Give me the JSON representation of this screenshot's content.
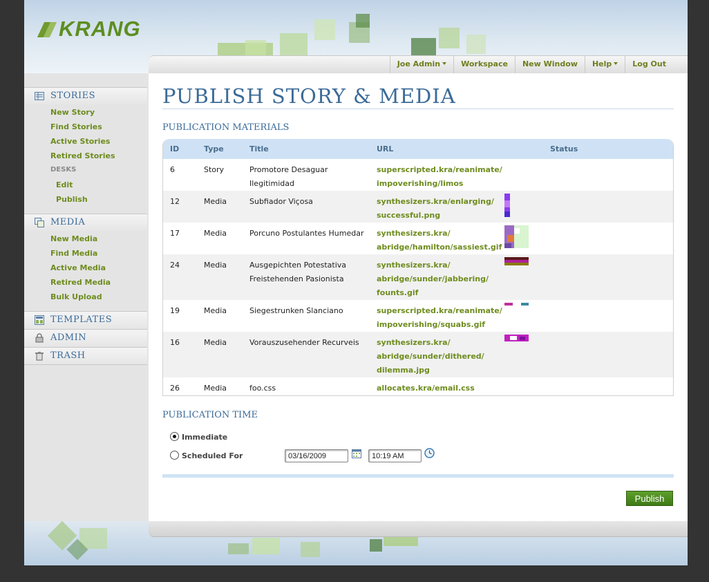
{
  "brand": {
    "name": "KRANG"
  },
  "nav": {
    "user": "Joe Admin",
    "workspace": "Workspace",
    "new_window": "New Window",
    "help": "Help",
    "logout": "Log Out"
  },
  "sidebar": {
    "stories": {
      "title": "STORIES",
      "new": "New Story",
      "find": "Find Stories",
      "active": "Active Stories",
      "retired": "Retired Stories",
      "desks_caption": "DESKS",
      "edit": "Edit",
      "publish": "Publish"
    },
    "media": {
      "title": "MEDIA",
      "new": "New Media",
      "find": "Find Media",
      "active": "Active Media",
      "retired": "Retired Media",
      "bulk": "Bulk Upload"
    },
    "templates": {
      "title": "TEMPLATES"
    },
    "admin": {
      "title": "ADMIN"
    },
    "trash": {
      "title": "TRASH"
    }
  },
  "page": {
    "title": "PUBLISH STORY & MEDIA",
    "materials_heading": "PUBLICATION MATERIALS",
    "time_heading": "PUBLICATION TIME"
  },
  "table": {
    "headers": {
      "id": "ID",
      "type": "Type",
      "title": "Title",
      "url": "URL",
      "status": "Status"
    },
    "rows": [
      {
        "id": "6",
        "type": "Story",
        "title1": "Promotore Desaguar",
        "title2": "Ilegitimidad",
        "title3": "",
        "url1": "superscripted.kra/reanimate/",
        "url2": "impoverishing/limos",
        "url3": ""
      },
      {
        "id": "12",
        "type": "Media",
        "title1": "Subfiador Viçosa",
        "title2": "",
        "title3": "",
        "url1": "synthesizers.kra/enlarging/",
        "url2": "successful.png",
        "url3": ""
      },
      {
        "id": "17",
        "type": "Media",
        "title1": "Porcuno Postulantes Humedar",
        "title2": "",
        "title3": "",
        "url1": "synthesizers.kra/",
        "url2": "abridge/hamilton/sassiest.gif",
        "url3": ""
      },
      {
        "id": "24",
        "type": "Media",
        "title1": "Ausgepichten Potestativa",
        "title2": "Freistehenden Pasionista",
        "title3": "",
        "url1": "synthesizers.kra/",
        "url2": "abridge/sunder/jabbering/",
        "url3": "founts.gif"
      },
      {
        "id": "19",
        "type": "Media",
        "title1": "Siegestrunken Slanciano",
        "title2": "",
        "title3": "",
        "url1": "superscripted.kra/reanimate/",
        "url2": "impoverishing/squabs.gif",
        "url3": ""
      },
      {
        "id": "16",
        "type": "Media",
        "title1": "Vorauszusehender Recurveis",
        "title2": "",
        "title3": "",
        "url1": "synthesizers.kra/",
        "url2": "abridge/sunder/dithered/",
        "url3": "dilemma.jpg"
      },
      {
        "id": "26",
        "type": "Media",
        "title1": "foo.css",
        "title2": "",
        "title3": "",
        "url1": "allocates.kra/email.css",
        "url2": "",
        "url3": ""
      }
    ]
  },
  "publish_time": {
    "immediate": "Immediate",
    "scheduled": "Scheduled For",
    "date": "03/16/2009",
    "time": "10:19 AM",
    "selected": "Immediate"
  },
  "actions": {
    "publish": "Publish"
  },
  "colors": {
    "accent_green": "#6e8c1e",
    "heading_blue": "#3b6b98",
    "table_header": "#cfe2f5"
  }
}
